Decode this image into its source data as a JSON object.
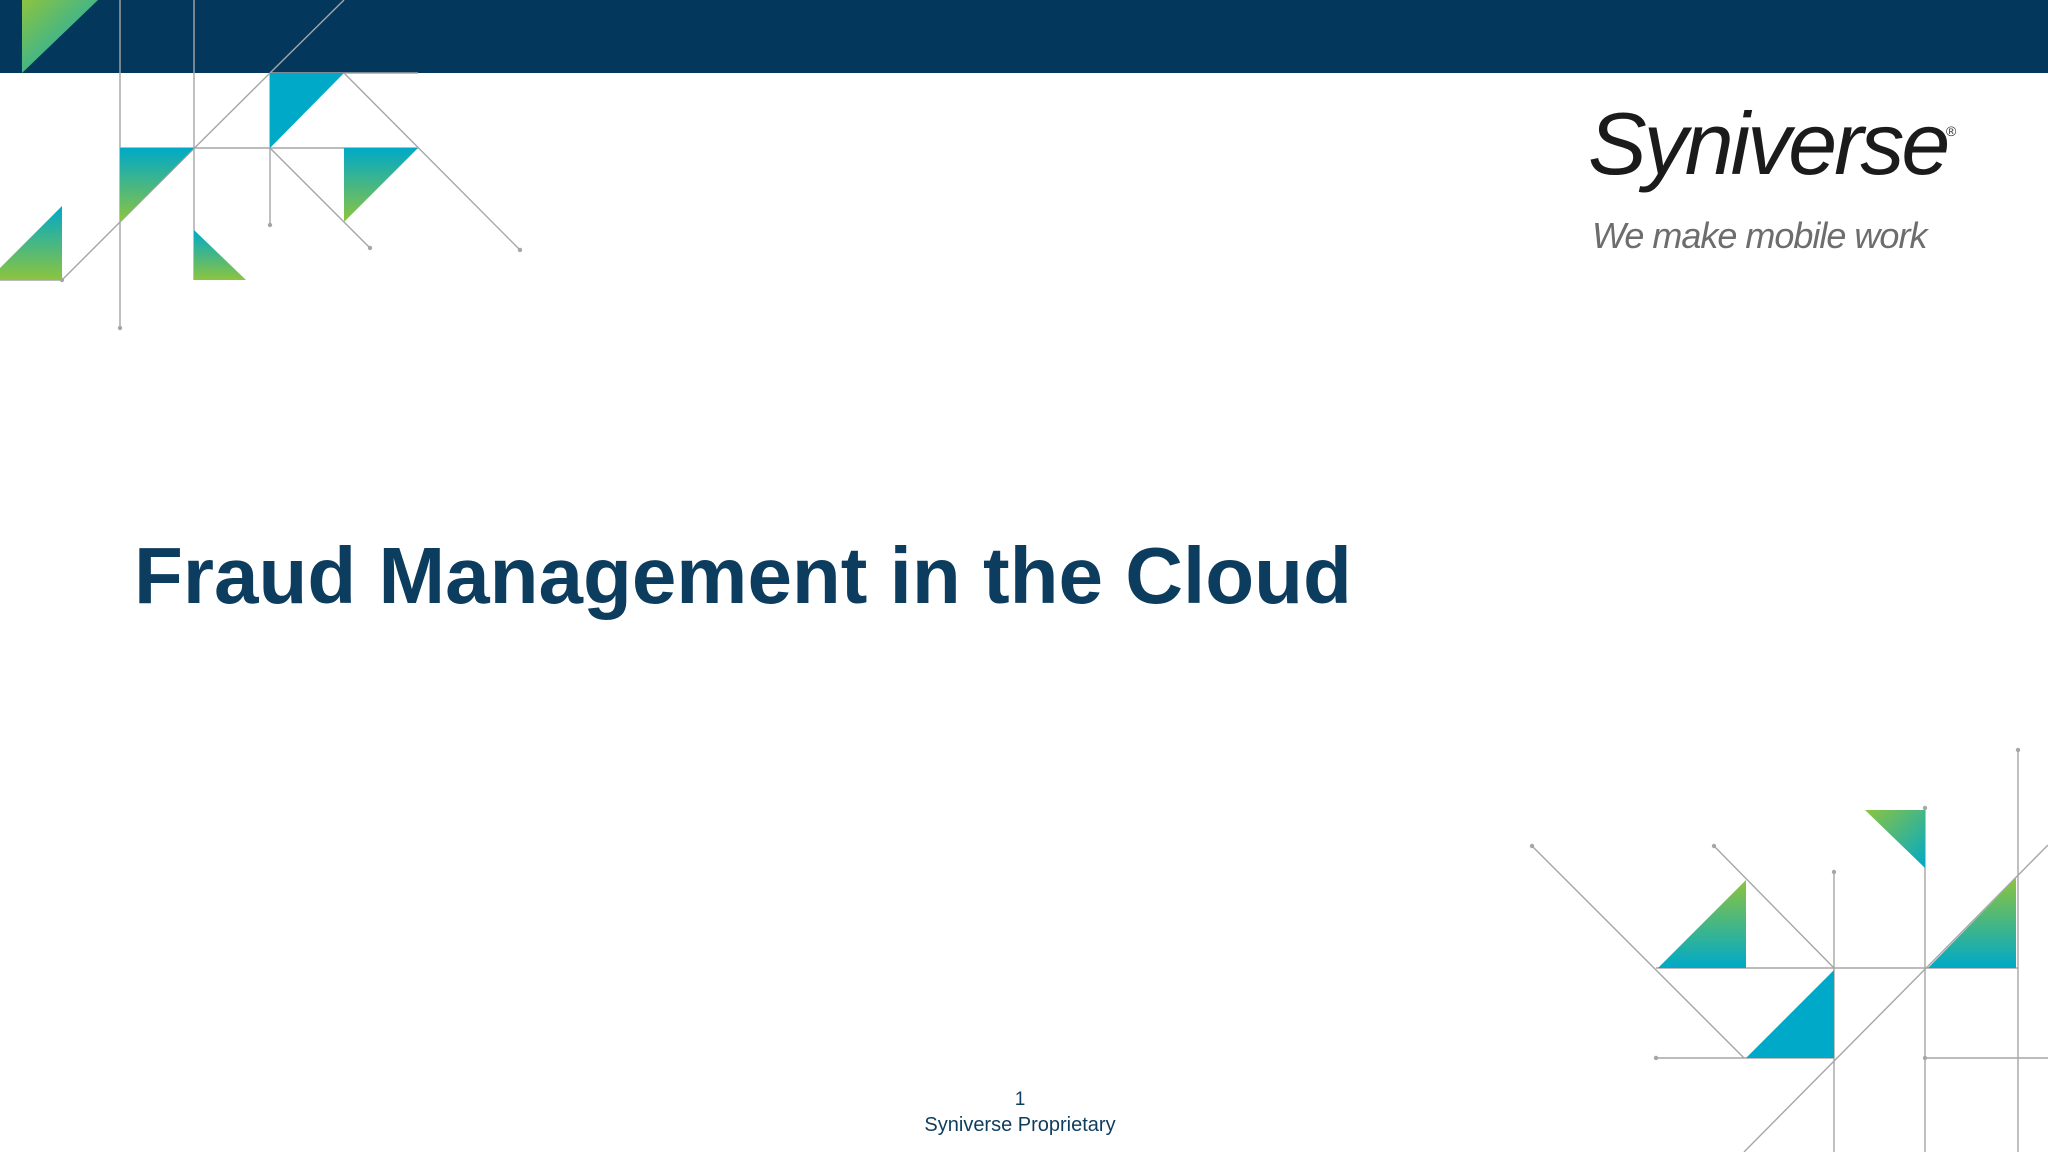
{
  "slide": {
    "title": "Fraud Management in the Cloud",
    "page_number": "1",
    "footer_note": "Syniverse Proprietary"
  },
  "logo": {
    "name": "Syniverse",
    "registered_mark": "®",
    "tagline": "We make mobile work"
  },
  "colors": {
    "header_bar": "#03385c",
    "title": "#0d3d5e",
    "accent_cyan": "#00a9c8",
    "accent_green": "#8cc43f",
    "line_gray": "#a6a6a6"
  },
  "icons": {
    "corner_decoration": "geometric-triangles"
  }
}
